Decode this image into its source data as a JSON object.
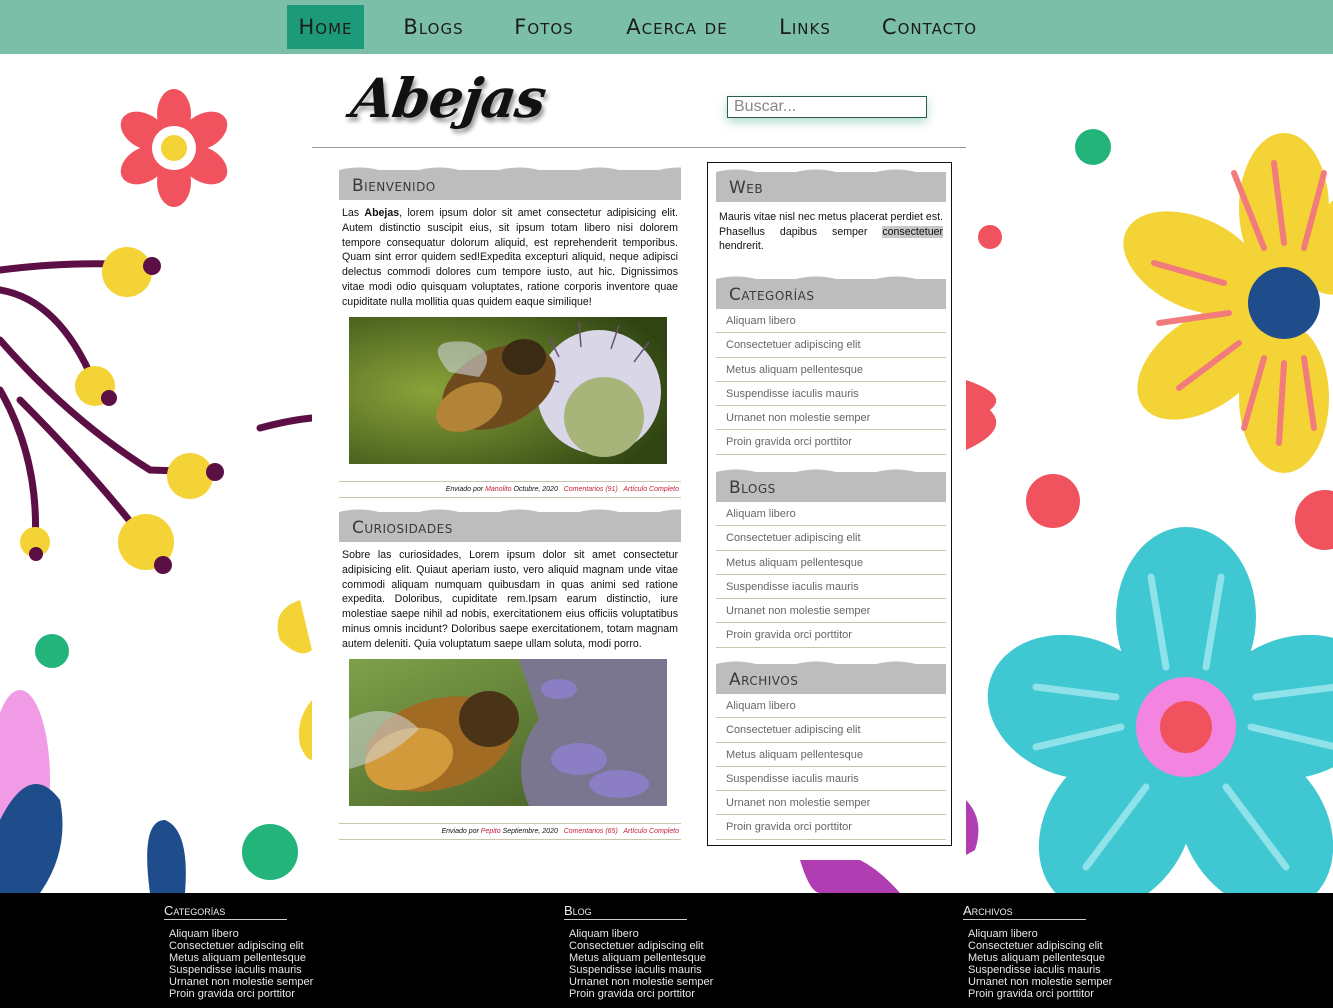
{
  "nav": {
    "items": [
      {
        "label": "Home",
        "active": true
      },
      {
        "label": "Blogs",
        "active": false
      },
      {
        "label": "Fotos",
        "active": false
      },
      {
        "label": "Acerca de",
        "active": false
      },
      {
        "label": "Links",
        "active": false
      },
      {
        "label": "Contacto",
        "active": false
      }
    ]
  },
  "header": {
    "logo": "Abejas",
    "search_placeholder": "Buscar..."
  },
  "posts": [
    {
      "title": "Bienvenido",
      "body_lead": "Las ",
      "body_bold": "Abejas",
      "body_rest": ", lorem ipsum dolor sit amet consectetur adipisicing elit. Autem distinctio suscipit eius, sit ipsum totam libero nisi dolorem tempore consequatur dolorum aliquid, est reprehenderit temporibus. Quam sint error quidem sed!Expedita excepturi aliquid, neque adipisci delectus commodi dolores cum tempore iusto, aut hic. Dignissimos vitae modi odio quisquam voluptates, ratione corporis inventore quae cupiditate nulla mollitia quas quidem eaque similique!",
      "meta": {
        "prefix": "Enviado por",
        "author": "Manolito",
        "date": "Octubre, 2020",
        "comments": "Comentarios (91)",
        "link": "Artículo Completo"
      }
    },
    {
      "title": "Curiosidades",
      "body": "Sobre las curiosidades, Lorem ipsum dolor sit amet consectetur adipisicing elit. Quiaut aperiam iusto, vero aliquid magnam unde vitae commodi aliquam numquam quibusdam in quas animi sed ratione expedita. Doloribus, cupiditate rem.Ipsam earum distinctio, iure molestiae saepe nihil ad nobis, exercitationem eius officiis voluptatibus minus omnis incidunt? Doloribus saepe exercitationem, totam magnam autem deleniti. Quia voluptatum saepe ullam soluta, modi porro.",
      "meta": {
        "prefix": "Enviado por",
        "author": "Pepito",
        "date": "Septiembre, 2020",
        "comments": "Comentarios (65)",
        "link": "Artículo Completo"
      }
    }
  ],
  "sidebar": {
    "web": {
      "title": "Web",
      "text_before": "Mauris vitae nisl nec metus placerat perdiet est. Phasellus dapibus semper ",
      "text_highlight": "consectetuer",
      "text_after": " hendrerit."
    },
    "lists": [
      {
        "title": "Categorías",
        "items": [
          "Aliquam libero",
          "Consectetuer adipiscing elit",
          "Metus aliquam pellentesque",
          "Suspendisse iaculis mauris",
          "Urnanet non molestie semper",
          "Proin gravida orci porttitor"
        ]
      },
      {
        "title": "Blogs",
        "items": [
          "Aliquam libero",
          "Consectetuer adipiscing elit",
          "Metus aliquam pellentesque",
          "Suspendisse iaculis mauris",
          "Urnanet non molestie semper",
          "Proin gravida orci porttitor"
        ]
      },
      {
        "title": "Archivos",
        "items": [
          "Aliquam libero",
          "Consectetuer adipiscing elit",
          "Metus aliquam pellentesque",
          "Suspendisse iaculis mauris",
          "Urnanet non molestie semper",
          "Proin gravida orci porttitor"
        ]
      }
    ]
  },
  "footer": {
    "columns": [
      {
        "title": "Categorías",
        "items": [
          "Aliquam libero",
          "Consectetuer adipiscing elit",
          "Metus aliquam pellentesque",
          "Suspendisse iaculis mauris",
          "Urnanet non molestie semper",
          "Proin gravida orci porttitor"
        ]
      },
      {
        "title": "Blog",
        "items": [
          "Aliquam libero",
          "Consectetuer adipiscing elit",
          "Metus aliquam pellentesque",
          "Suspendisse iaculis mauris",
          "Urnanet non molestie semper",
          "Proin gravida orci porttitor"
        ]
      },
      {
        "title": "Archivos",
        "items": [
          "Aliquam libero",
          "Consectetuer adipiscing elit",
          "Metus aliquam pellentesque",
          "Suspendisse iaculis mauris",
          "Urnanet non molestie semper",
          "Proin gravida orci porttitor"
        ]
      }
    ]
  },
  "colors": {
    "nav_bg": "#7bbfa9",
    "nav_active": "#1d9a78",
    "heading_bg": "#bdbdbd",
    "meta_link": "#c0223b",
    "footer_bg": "#000000"
  }
}
